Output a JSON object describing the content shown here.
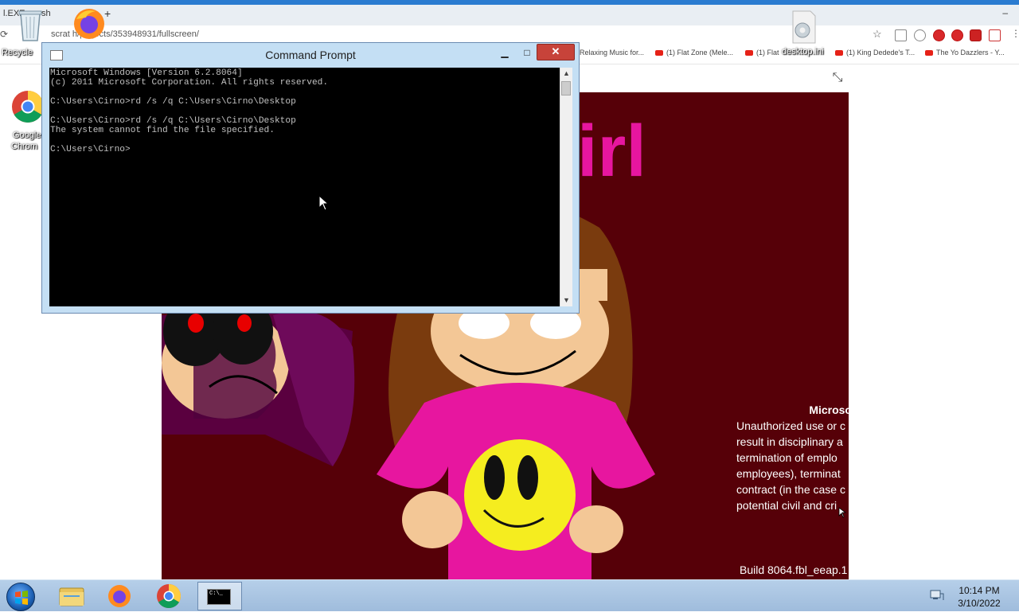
{
  "browser": {
    "tab_title_1": "l.EXE",
    "tab_title_2": "sh",
    "new_tab": "+",
    "url": "scrat      h/projects/353948931/fullscreen/",
    "minimize": "–",
    "bookmarks": [
      {
        "label": "Relaxing Music for..."
      },
      {
        "label": "(1) Flat Zone (Mele..."
      },
      {
        "label": "(1) Flat"
      },
      {
        "label": "(1) King Dedede's T..."
      },
      {
        "label": "The Yo Dazzlers - Y..."
      }
    ],
    "fullscreen_exit_icon": "fullscreen-exit-icon"
  },
  "desktop": {
    "recycle_bin": "Recycle",
    "chrome_label_1": "Google",
    "chrome_label_2": "Chrom",
    "desktop_ini": "desktop.ini"
  },
  "stage": {
    "title_fragment": "irl",
    "license_title": "Microso",
    "license_lines": [
      "Unauthorized use or c",
      "result in disciplinary a",
      "termination of emplo",
      "employees), terminat",
      "contract (in the case c",
      "potential civil and cri"
    ],
    "build": "Build 8064.fbl_eeap.1"
  },
  "cmd": {
    "title": "Command Prompt",
    "minimize": "▁",
    "maximize": "□",
    "close": "✕",
    "console_text": "Microsoft Windows [Version 6.2.8064]\n(c) 2011 Microsoft Corporation. All rights reserved.\n\nC:\\Users\\Cirno>rd /s /q C:\\Users\\Cirno\\Desktop\n\nC:\\Users\\Cirno>rd /s /q C:\\Users\\Cirno\\Desktop\nThe system cannot find the file specified.\n\nC:\\Users\\Cirno>",
    "scroll_up": "▲",
    "scroll_down": "▼"
  },
  "taskbar": {
    "time": "10:14 PM",
    "date": "3/10/2022",
    "cmd_icon_text": "C:\\_"
  },
  "colors": {
    "stage_bg": "#560008",
    "cmd_frame": "#c4dff4",
    "close_red": "#c7433a",
    "shirt_pink": "#e7169f",
    "smiley_yellow": "#f5ed1f"
  }
}
